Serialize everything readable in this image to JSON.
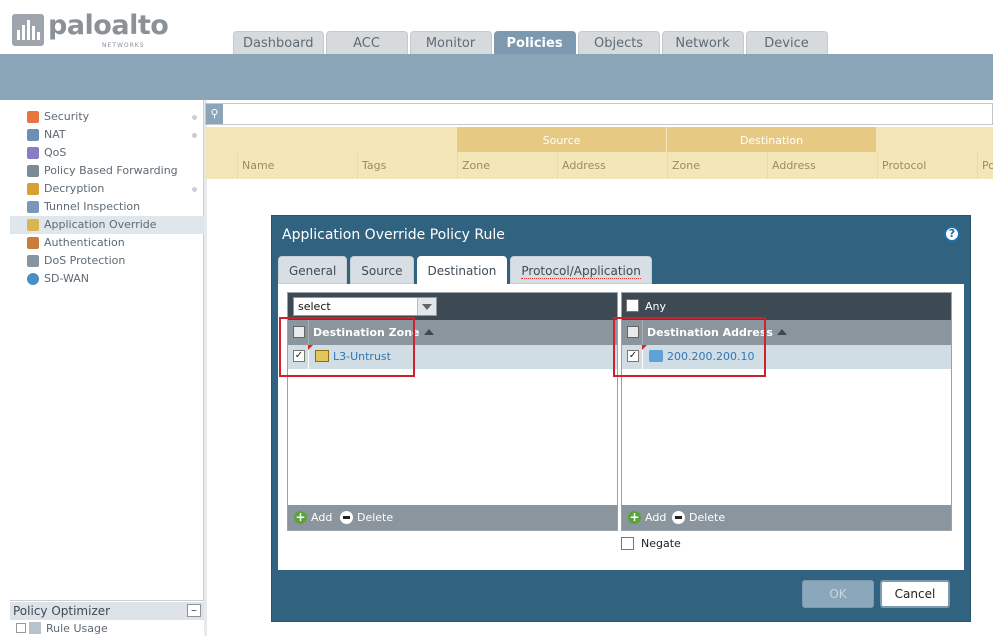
{
  "brand": {
    "name": "paloalto",
    "sub": "NETWORKS"
  },
  "topnav": {
    "tabs": [
      {
        "label": "Dashboard"
      },
      {
        "label": "ACC"
      },
      {
        "label": "Monitor"
      },
      {
        "label": "Policies",
        "active": true
      },
      {
        "label": "Objects"
      },
      {
        "label": "Network"
      },
      {
        "label": "Device"
      }
    ]
  },
  "sidebar": {
    "items": [
      {
        "label": "Security",
        "icon": "security-icon",
        "color": "#e9743f"
      },
      {
        "label": "NAT",
        "icon": "nat-icon",
        "color": "#6e8fb3"
      },
      {
        "label": "QoS",
        "icon": "qos-icon",
        "color": "#8a7cc0"
      },
      {
        "label": "Policy Based Forwarding",
        "icon": "pbf-icon",
        "color": "#7b8b96"
      },
      {
        "label": "Decryption",
        "icon": "decryption-icon",
        "color": "#d8a030"
      },
      {
        "label": "Tunnel Inspection",
        "icon": "tunnel-icon",
        "color": "#7a97b8"
      },
      {
        "label": "Application Override",
        "icon": "app-override-icon",
        "color": "#d9b74f",
        "selected": true
      },
      {
        "label": "Authentication",
        "icon": "authentication-icon",
        "color": "#c97d3a"
      },
      {
        "label": "DoS Protection",
        "icon": "dos-icon",
        "color": "#8795a0"
      },
      {
        "label": "SD-WAN",
        "icon": "sdwan-icon",
        "color": "#4a8fc4"
      }
    ]
  },
  "optimizer": {
    "title": "Policy Optimizer",
    "collapse": "–",
    "rule_usage": "Rule Usage"
  },
  "grid": {
    "groups": [
      "Source",
      "Destination"
    ],
    "columns": [
      "Name",
      "Tags",
      "Zone",
      "Address",
      "Zone",
      "Address",
      "Protocol",
      "Po"
    ]
  },
  "dialog": {
    "title": "Application Override Policy Rule",
    "help": "?",
    "tabs": [
      "General",
      "Source",
      "Destination",
      "Protocol/Application"
    ],
    "active_tab": "Destination",
    "zone_panel": {
      "select_value": "select",
      "header": "Destination Zone",
      "rows": [
        {
          "checked": "✓",
          "value": "L3-Untrust"
        }
      ],
      "add": "Add",
      "delete": "Delete"
    },
    "address_panel": {
      "any_label": "Any",
      "header": "Destination Address",
      "rows": [
        {
          "checked": "✓",
          "value": "200.200.200.10"
        }
      ],
      "add": "Add",
      "delete": "Delete"
    },
    "negate_label": "Negate",
    "ok": "OK",
    "cancel": "Cancel"
  },
  "colors": {
    "accent": "#7d99b0",
    "dialog_bg": "#31627f",
    "highlight": "#d0202a",
    "link": "#2e78b5"
  }
}
